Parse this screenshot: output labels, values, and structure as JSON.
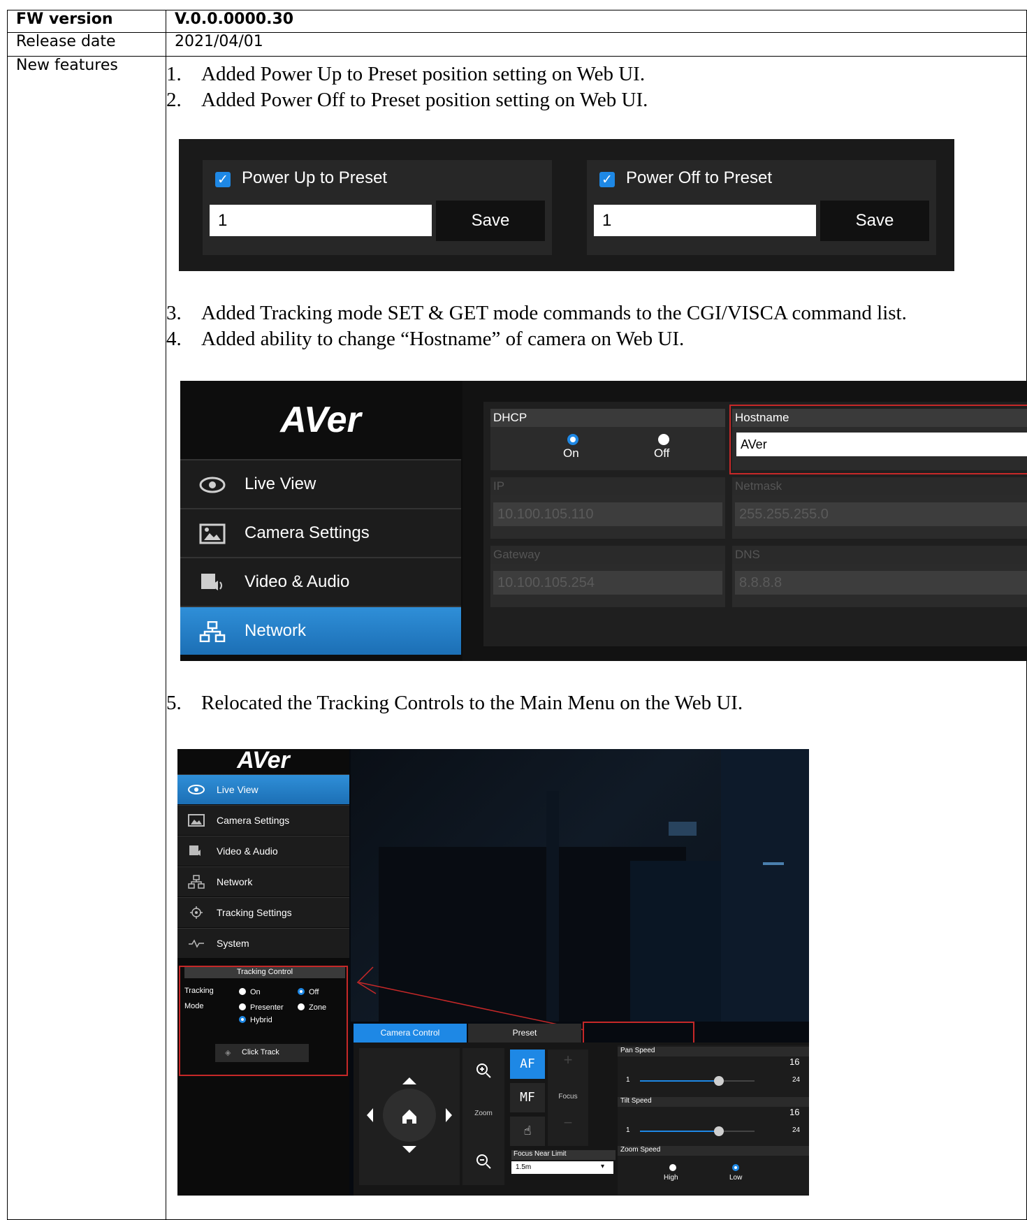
{
  "table": {
    "rows": [
      {
        "label": "FW version",
        "value": "V.0.0.0000.30"
      },
      {
        "label": "Release date",
        "value": "2021/04/01"
      },
      {
        "label": "New features"
      }
    ]
  },
  "features": [
    {
      "num": "1.",
      "text": "Added Power Up to Preset position setting on Web UI."
    },
    {
      "num": "2.",
      "text": "Added Power Off to Preset position setting on Web UI."
    },
    {
      "num": "3.",
      "text": "Added Tracking mode SET & GET mode commands to the CGI/VISCA command list."
    },
    {
      "num": "4.",
      "text": "Added ability to change “Hostname” of camera on Web UI."
    },
    {
      "num": "5.",
      "text": "Relocated the Tracking Controls to the Main Menu on the Web UI."
    }
  ],
  "shot1": {
    "check_mark": "✓",
    "power_up": {
      "label": "Power Up to Preset",
      "value": "1",
      "save": "Save"
    },
    "power_off": {
      "label": "Power Off to Preset",
      "value": "1",
      "save": "Save"
    },
    "accent_color": "#1e88e5"
  },
  "shot2": {
    "logo": "AVer",
    "nav": [
      {
        "label": "Live View",
        "icon": "eye-icon"
      },
      {
        "label": "Camera Settings",
        "icon": "image-icon"
      },
      {
        "label": "Video & Audio",
        "icon": "video-audio-icon"
      },
      {
        "label": "Network",
        "icon": "network-icon"
      }
    ],
    "active_nav": "Network",
    "dhcp": {
      "label": "DHCP",
      "on": "On",
      "off": "Off",
      "selected": "On"
    },
    "hostname": {
      "label": "Hostname",
      "value": "AVer"
    },
    "ip": {
      "label": "IP",
      "value": "10.100.105.110"
    },
    "netmask": {
      "label": "Netmask",
      "value": "255.255.255.0"
    },
    "gateway": {
      "label": "Gateway",
      "value": "10.100.105.254"
    },
    "dns": {
      "label": "DNS",
      "value": "8.8.8.8"
    },
    "highlight_color": "#c62828"
  },
  "shot3": {
    "logo": "AVer",
    "nav": [
      {
        "label": "Live View",
        "icon": "eye-icon"
      },
      {
        "label": "Camera Settings",
        "icon": "image-icon"
      },
      {
        "label": "Video & Audio",
        "icon": "video-audio-icon"
      },
      {
        "label": "Network",
        "icon": "network-icon"
      },
      {
        "label": "Tracking Settings",
        "icon": "crosshair-icon"
      },
      {
        "label": "System",
        "icon": "pulse-icon"
      }
    ],
    "active_nav": "Live View",
    "tracking_control": {
      "title": "Tracking Control",
      "tracking_label": "Tracking",
      "on": "On",
      "off": "Off",
      "tracking_selected": "Off",
      "mode_label": "Mode",
      "presenter": "Presenter",
      "zone": "Zone",
      "hybrid": "Hybrid",
      "mode_selected": "Hybrid",
      "click_track": "Click Track"
    },
    "tabs": [
      "Camera Control",
      "Preset"
    ],
    "active_tab": "Camera Control",
    "zoom_label": "Zoom",
    "focus_label": "Focus",
    "af": "AF",
    "mf": "MF",
    "focus_near_limit": {
      "label": "Focus Near Limit",
      "value": "1.5m"
    },
    "pan_speed": {
      "label": "Pan Speed",
      "value": "16",
      "min": "1",
      "max": "24"
    },
    "tilt_speed": {
      "label": "Tilt Speed",
      "value": "16",
      "min": "1",
      "max": "24"
    },
    "zoom_speed": {
      "label": "Zoom Speed",
      "high": "High",
      "low": "Low",
      "selected": "Low"
    }
  }
}
